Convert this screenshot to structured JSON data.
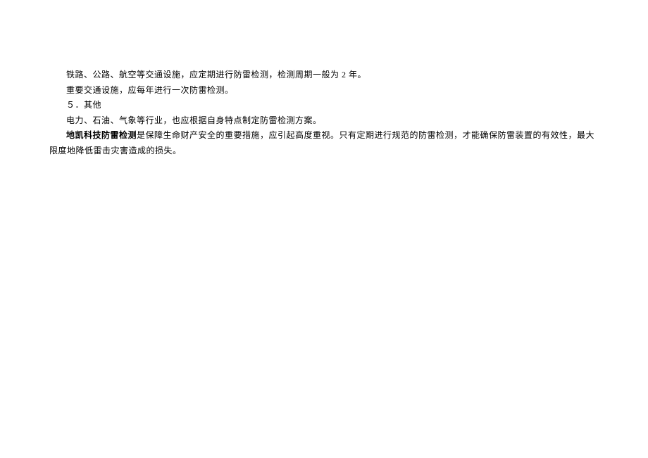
{
  "doc": {
    "line1": "铁路、公路、航空等交通设施，应定期进行防雷检测，检测周期一般为 2 年。",
    "line2": "重要交通设施，应每年进行一次防雷检测。",
    "line3": "５．其他",
    "line4": "电力、石油、气象等行业，也应根据自身特点制定防雷检测方案。",
    "line5_bold": "地凯科技防雷检测",
    "line5_rest": "是保障生命财产安全的重要措施，应引起高度重视。只有定期进行规范的防雷检测，才能确保防雷装置的有效性，最大限度地降低雷击灾害造成的损失。"
  }
}
